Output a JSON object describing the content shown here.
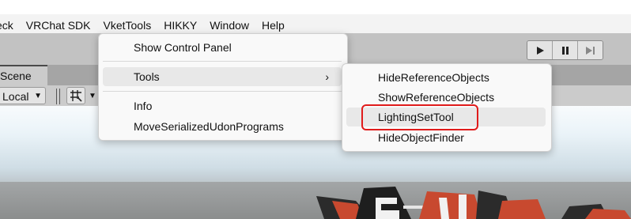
{
  "menubar": {
    "items": [
      {
        "label": "eck"
      },
      {
        "label": "VRChat SDK"
      },
      {
        "label": "VketTools"
      },
      {
        "label": "HIKKY"
      },
      {
        "label": "Window"
      },
      {
        "label": "Help"
      }
    ]
  },
  "scene": {
    "tab_label": "Scene",
    "pivot_dropdown": "Local"
  },
  "vkettools_menu": {
    "items": [
      {
        "label": "Show Control Panel"
      },
      {
        "label": "Tools"
      },
      {
        "label": "Info"
      },
      {
        "label": "MoveSerializedUdonPrograms"
      }
    ]
  },
  "tools_submenu": {
    "items": [
      {
        "label": "HideReferenceObjects"
      },
      {
        "label": "ShowReferenceObjects"
      },
      {
        "label": "LightingSetTool"
      },
      {
        "label": "HideObjectFinder"
      }
    ]
  },
  "annotation": {
    "color": "#e01b1b",
    "target": "LightingSetTool"
  },
  "icons": [
    "play-icon",
    "pause-icon",
    "step-icon",
    "grid-snap-icon",
    "chevron-right-icon"
  ]
}
